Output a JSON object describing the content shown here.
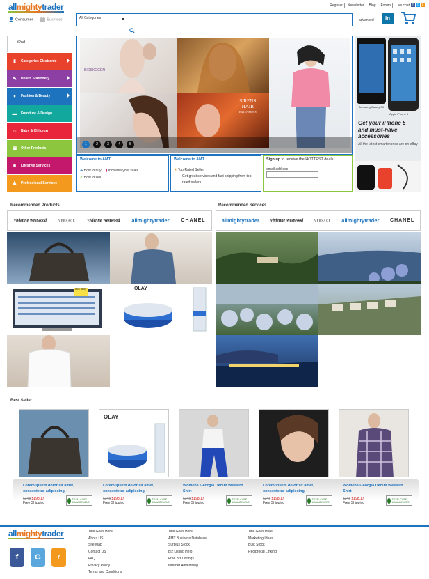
{
  "header": {
    "logo": {
      "part1": "all",
      "part2": "mighty",
      "part3": "trader"
    },
    "top_links": [
      "Register",
      "Newsletter",
      "Blog",
      "Forum",
      "Live chat"
    ],
    "social": [
      "f",
      "t",
      "r"
    ],
    "account_options": [
      "Consumer",
      "Business"
    ],
    "search": {
      "category": "All Categories",
      "placeholder": ""
    },
    "advanced_label": "advanced",
    "linkedin_label": "in"
  },
  "sidebar": {
    "top_item": "iPod",
    "items": [
      {
        "label": "Categories  Electronic",
        "color": "#e8412c"
      },
      {
        "label": "Health Stationery",
        "color": "#8e3fa3"
      },
      {
        "label": "Fashion & Beauty",
        "color": "#1e73be"
      },
      {
        "label": "Furniture & Design",
        "color": "#12a89d"
      },
      {
        "label": "Baby & Children",
        "color": "#e8253b"
      },
      {
        "label": "Other Products",
        "color": "#8cc63f"
      },
      {
        "label": "Lifestyle Services",
        "color": "#c3186b"
      },
      {
        "label": "Professional Services",
        "color": "#f39a1e"
      }
    ]
  },
  "slider": {
    "texts": {
      "brand": "BIOSKOGEN",
      "sirens1": "SIRENS",
      "sirens2": "HAIR",
      "sirens3": "EXTENSIONS"
    },
    "dots": [
      "1",
      "2",
      "3",
      "4",
      "5"
    ]
  },
  "welcome": {
    "box1": {
      "title": "Welcome to AMT",
      "items": [
        "How to buy",
        "Increase your sales",
        "How to sell"
      ]
    },
    "box2": {
      "title": "Welcome to AMT",
      "item": "Top-Rated Seller",
      "desc": "Get great services and fast shipping from top-rated sellers."
    },
    "box3": {
      "title_bold": "Sign up",
      "title_rest": " to receive the HOTTEST deals",
      "email_label": "email address"
    }
  },
  "ad": {
    "phone1_label": "Samsung Galaxy SII",
    "phone2_label": "Apple iPhone 5",
    "headline1": "Get your iPhone 5",
    "headline2": "and must-have accessories",
    "sub": "All the latest smartphones are on eBay"
  },
  "recommended_products": {
    "title": "Recommended Products",
    "brands": [
      "Vivienne Westwood",
      "VERSACE",
      "Vivienne Westwood",
      "allmightytrader",
      "CHANEL"
    ],
    "olay_label": "OLAY",
    "screen_note": "click study"
  },
  "recommended_services": {
    "title": "Recommended Services",
    "brands": [
      "allmightytrader",
      "Vivienne Westwood",
      "VERSACE",
      "allmightytrader",
      "CHANEL"
    ]
  },
  "best_seller": {
    "title": "Best Seller",
    "items": [
      {
        "title": "Lorem ipsum dolor sit amet, consectetur adipiscing",
        "old": "$348",
        "new": "$198.17",
        "ship": "Free Shipping"
      },
      {
        "title": "Lorem ipsum dolor sit amet, consectetur adipiscing",
        "old": "$348",
        "new": "$198.17",
        "ship": "Free Shipping",
        "brand": "OLAY"
      },
      {
        "title": "Womens Georgia Denim Western Shirt",
        "old": "$348",
        "new": "$198.17",
        "ship": "Free Shipping"
      },
      {
        "title": "Lorem ipsum dolor sit amet, consectetur adipiscing",
        "old": "$348",
        "new": "$198.17",
        "ship": "Free Shipping"
      },
      {
        "title": "Womens Georgia Denim Western Shirt",
        "old": "$348",
        "new": "$198.17",
        "ship": "Free Shipping"
      }
    ],
    "seal_text": "TOTAL CARE MANAGEMENT"
  },
  "footer": {
    "col1": [
      "Title Goes Here",
      "About US",
      "Site Map",
      "Contact US",
      "FAQ",
      "Privacy Policy",
      "Terms and Conditions"
    ],
    "col2": [
      "Title Goes Here",
      "AMT Business Database",
      "Surplus Stock",
      "Biz Listing Help",
      "Free Biz Listings",
      "Internet Advertising"
    ],
    "col3": [
      "Title Goes Here",
      "Marketing Ideas",
      "Bulk Stock",
      "Reciprocal Linking"
    ],
    "social_icons": [
      "f",
      "G",
      "r"
    ]
  },
  "colors": {
    "brand_blue": "#1e73be",
    "brand_orange": "#e87722",
    "brand_green": "#8cc63f"
  }
}
